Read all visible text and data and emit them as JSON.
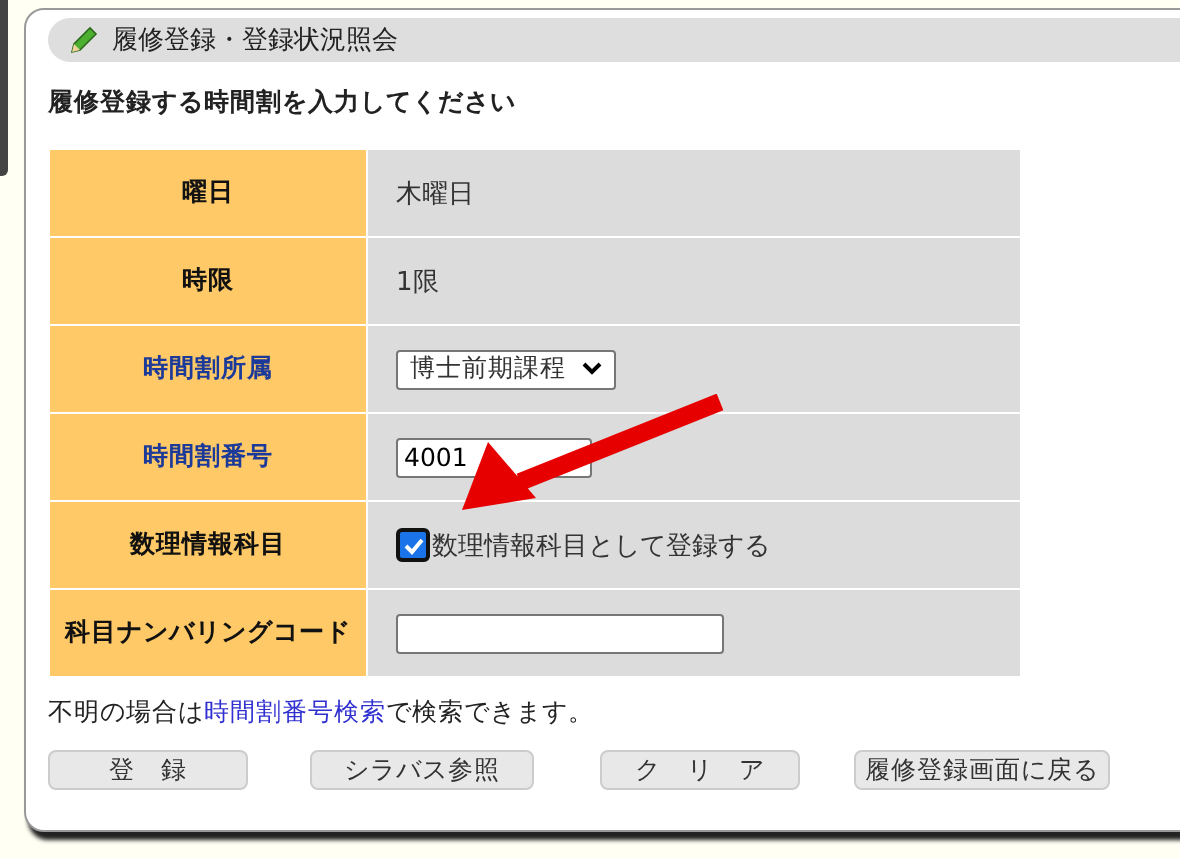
{
  "header": {
    "title": "履修登録・登録状況照会"
  },
  "instruction": "履修登録する時間割を入力してください",
  "form_rows": [
    {
      "label": "曜日",
      "link": false,
      "kind": "text",
      "value": "木曜日"
    },
    {
      "label": "時限",
      "link": false,
      "kind": "text",
      "value": "1限"
    },
    {
      "label": "時間割所属",
      "link": true,
      "kind": "select",
      "value": "博士前期課程"
    },
    {
      "label": "時間割番号",
      "link": true,
      "kind": "input",
      "value": "4001"
    },
    {
      "label": "数理情報科目",
      "link": false,
      "kind": "checkbox",
      "value": "数理情報科目として登録する",
      "checked": true
    },
    {
      "label": "科目ナンバリングコード",
      "link": false,
      "kind": "input",
      "value": ""
    }
  ],
  "note": {
    "before": "不明の場合は",
    "link": "時間割番号検索",
    "after": "で検索できます。"
  },
  "buttons": [
    "登　録",
    "シラバス参照",
    "ク　リ　ア",
    "履修登録画面に戻る"
  ]
}
